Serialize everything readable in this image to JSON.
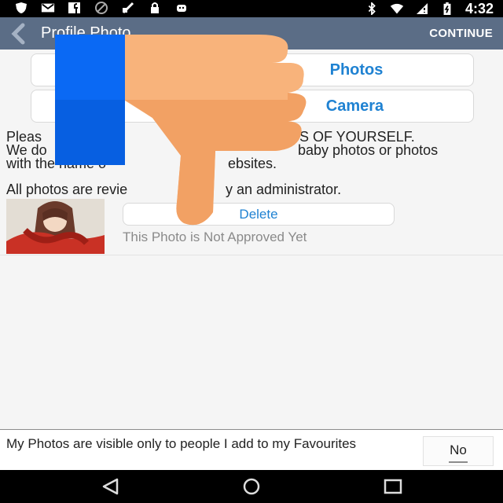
{
  "status_bar": {
    "time": "4:32",
    "icons": [
      "shield-icon",
      "mail-icon",
      "facebook-icon",
      "blocked-icon",
      "fax-icon",
      "lock-icon",
      "android-icon",
      "bluetooth-icon",
      "wifi-icon",
      "no-sim-icon",
      "battery-icon"
    ]
  },
  "app_bar": {
    "title": "Profile Photo",
    "continue_label": "CONTINUE",
    "background": "#5b6d86"
  },
  "buttons": {
    "photos_label": "Photos",
    "camera_label": "Camera",
    "delete_label": "Delete"
  },
  "info": {
    "line1_left": "Pleas",
    "line1_right": "S OF YOURSELF.",
    "line2_left": "We do",
    "line2_right": "baby photos or photos",
    "line3_left": "with the name o",
    "line3_right": "ebsites.",
    "review_left": "All photos are revie",
    "review_right": "y an administrator."
  },
  "photo": {
    "status": "This Photo is Not Approved Yet"
  },
  "visibility": {
    "text": "My Photos are visible only to people I add to my Favourites",
    "toggle_value": "No"
  },
  "colors": {
    "accent": "#1f82d2",
    "thumb_blue": "#0a69f4",
    "thumb_skin": "#f8b37b"
  }
}
